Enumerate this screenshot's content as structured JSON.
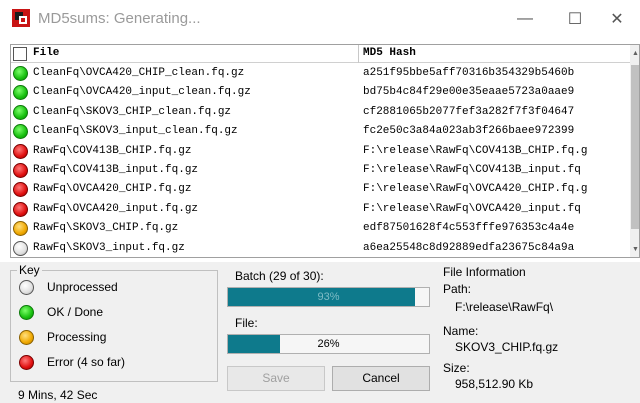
{
  "window": {
    "title": "MD5sums: Generating...",
    "minimize": "—",
    "maximize": "☐",
    "close": "✕"
  },
  "list": {
    "columns": {
      "file": "File",
      "hash": "MD5 Hash"
    },
    "rows": [
      {
        "status": "green",
        "file": "CleanFq\\OVCA420_CHIP_clean.fq.gz",
        "hash": "a251f95bbe5aff70316b354329b5460b"
      },
      {
        "status": "green",
        "file": "CleanFq\\OVCA420_input_clean.fq.gz",
        "hash": "bd75b4c84f29e00e35eaae5723a0aae9"
      },
      {
        "status": "green",
        "file": "CleanFq\\SKOV3_CHIP_clean.fq.gz",
        "hash": "cf2881065b2077fef3a282f7f3f04647"
      },
      {
        "status": "green",
        "file": "CleanFq\\SKOV3_input_clean.fq.gz",
        "hash": "fc2e50c3a84a023ab3f266baee972399"
      },
      {
        "status": "red",
        "file": "RawFq\\COV413B_CHIP.fq.gz",
        "hash": "F:\\release\\RawFq\\COV413B_CHIP.fq.g"
      },
      {
        "status": "red",
        "file": "RawFq\\COV413B_input.fq.gz",
        "hash": "F:\\release\\RawFq\\COV413B_input.fq"
      },
      {
        "status": "red",
        "file": "RawFq\\OVCA420_CHIP.fq.gz",
        "hash": "F:\\release\\RawFq\\OVCA420_CHIP.fq.g"
      },
      {
        "status": "red",
        "file": "RawFq\\OVCA420_input.fq.gz",
        "hash": "F:\\release\\RawFq\\OVCA420_input.fq"
      },
      {
        "status": "orange",
        "file": "RawFq\\SKOV3_CHIP.fq.gz",
        "hash": "edf87501628f4c553fffe976353c4a4e"
      },
      {
        "status": "gray",
        "file": "RawFq\\SKOV3_input.fq.gz",
        "hash": "a6ea25548c8d92889edfa23675c84a9a"
      }
    ]
  },
  "key": {
    "title": "Key",
    "items": [
      {
        "status": "gray",
        "label": "Unprocessed"
      },
      {
        "status": "green",
        "label": "OK / Done"
      },
      {
        "status": "orange",
        "label": "Processing"
      },
      {
        "status": "red",
        "label": "Error  (4 so far)"
      }
    ]
  },
  "elapsed": "9 Mins, 42 Sec",
  "batch": {
    "label": "Batch (29 of 30):",
    "percent_text": "93%",
    "fraction": 0.93
  },
  "file_progress": {
    "label": "File:",
    "percent_text": "26%",
    "fraction": 0.26
  },
  "buttons": {
    "save": "Save",
    "cancel": "Cancel"
  },
  "file_info": {
    "title": "File Information",
    "path_label": "Path:",
    "path_value": "F:\\release\\RawFq\\",
    "name_label": "Name:",
    "name_value": "SKOV3_CHIP.fq.gz",
    "size_label": "Size:",
    "size_value": "958,512.90 Kb"
  },
  "colors": {
    "progress_fill": "#0e7a8c",
    "status_green": "#19c010",
    "status_red": "#e01010",
    "status_orange": "#f0a800",
    "status_gray": "#e0e0e0"
  },
  "icons": {
    "app": "md5sums-app-icon",
    "status_dot": "status-light-icon"
  }
}
